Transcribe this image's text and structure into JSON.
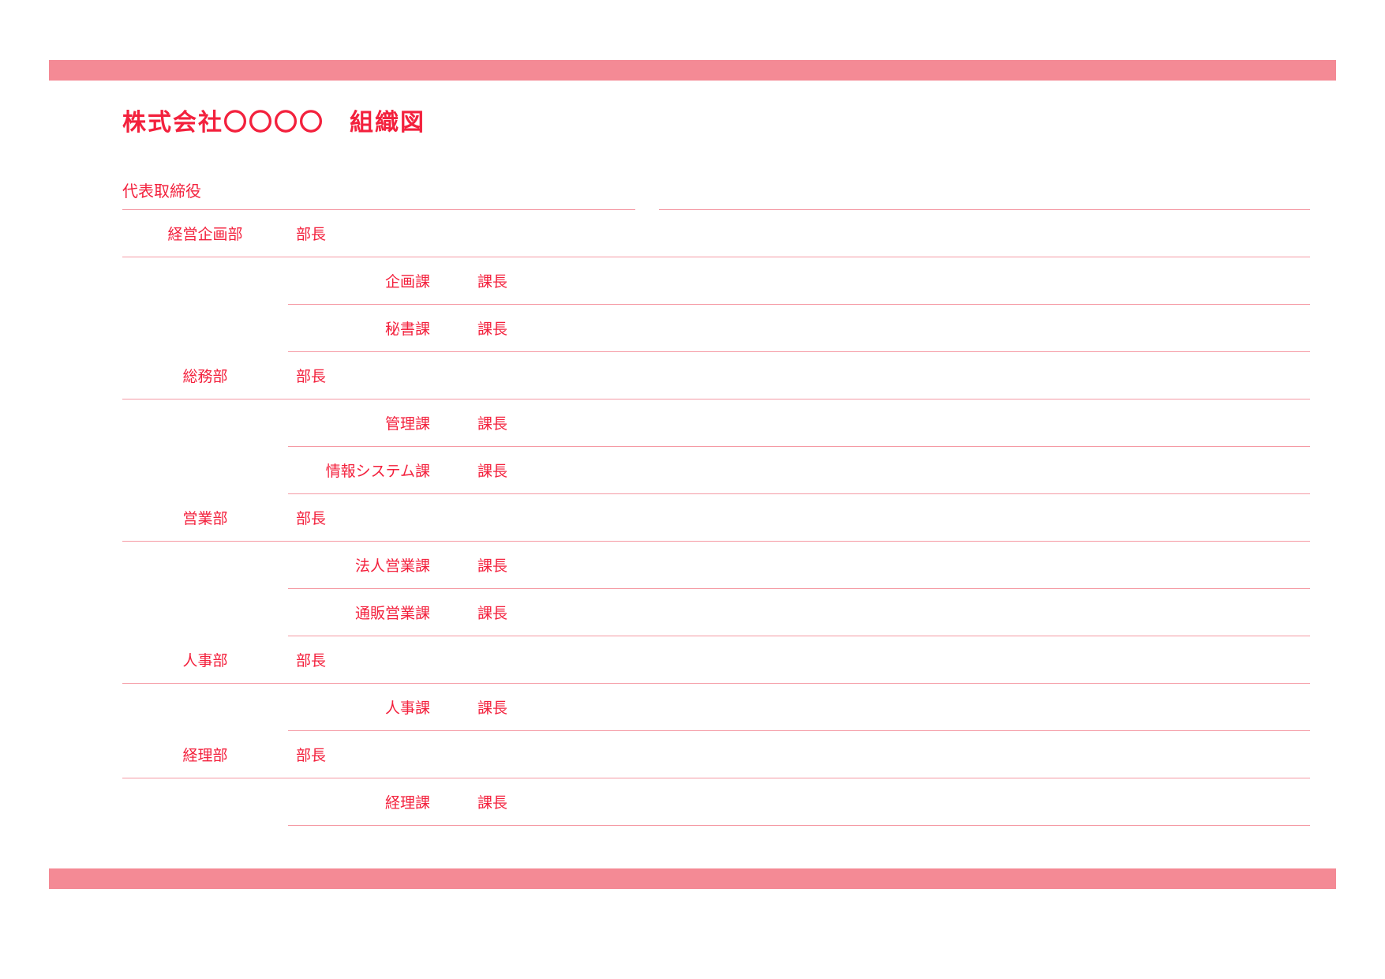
{
  "title": "株式会社〇〇〇〇　組織図",
  "root": "代表取締役",
  "deptHeadLabel": "部長",
  "sectHeadLabel": "課長",
  "departments": [
    {
      "name": "経営企画部",
      "sections": [
        {
          "name": "企画課"
        },
        {
          "name": "秘書課"
        }
      ]
    },
    {
      "name": "総務部",
      "sections": [
        {
          "name": "管理課"
        },
        {
          "name": "情報システム課"
        }
      ]
    },
    {
      "name": "営業部",
      "sections": [
        {
          "name": "法人営業課"
        },
        {
          "name": "通販営業課"
        }
      ]
    },
    {
      "name": "人事部",
      "sections": [
        {
          "name": "人事課"
        }
      ]
    },
    {
      "name": "経理部",
      "sections": [
        {
          "name": "経理課"
        }
      ]
    }
  ]
}
